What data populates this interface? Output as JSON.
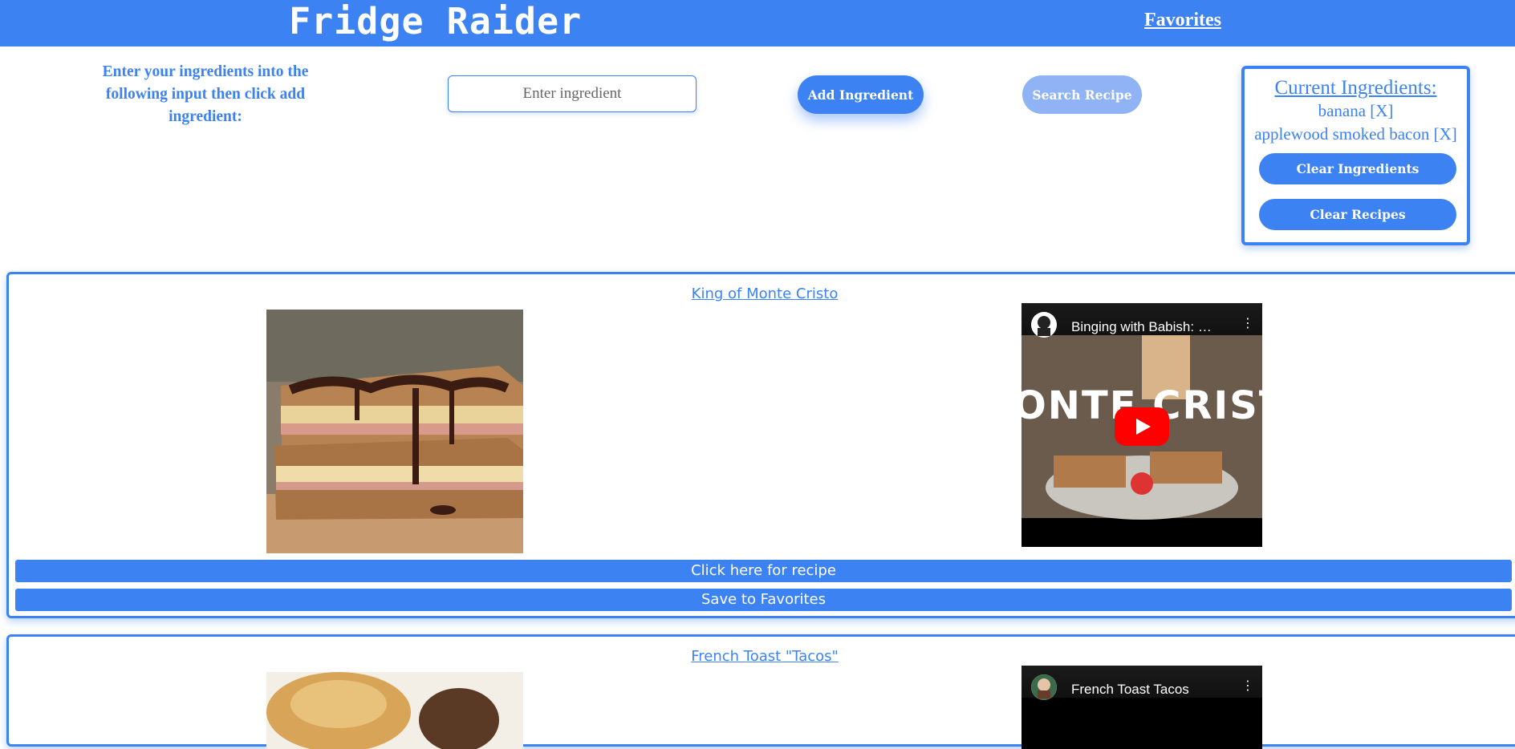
{
  "header": {
    "brand": "Fridge Raider",
    "favorites_link": "Favorites"
  },
  "controls": {
    "instructions": "Enter your ingredients into the following input then click add ingredient:",
    "ingredient_placeholder": "Enter ingredient",
    "add_button": "Add Ingredient",
    "search_button": "Search Recipe"
  },
  "ingredients_panel": {
    "title": "Current Ingredients:",
    "items": [
      "banana [X]",
      "applewood smoked bacon [X]"
    ],
    "clear_ingredients": "Clear Ingredients",
    "clear_recipes": "Clear Recipes"
  },
  "recipes": [
    {
      "title": "King of Monte Cristo",
      "video_title": "Binging with Babish: Monte Cristo",
      "video_overlay_text": "ONTE CRIST",
      "recipe_button": "Click here for recipe",
      "save_button": "Save to Favorites"
    },
    {
      "title": "French Toast \"Tacos\"",
      "video_title": "French Toast Tacos"
    }
  ],
  "colors": {
    "primary": "#3d82f3",
    "disabled": "#8fb3f5",
    "youtube_red": "#ff0000"
  }
}
